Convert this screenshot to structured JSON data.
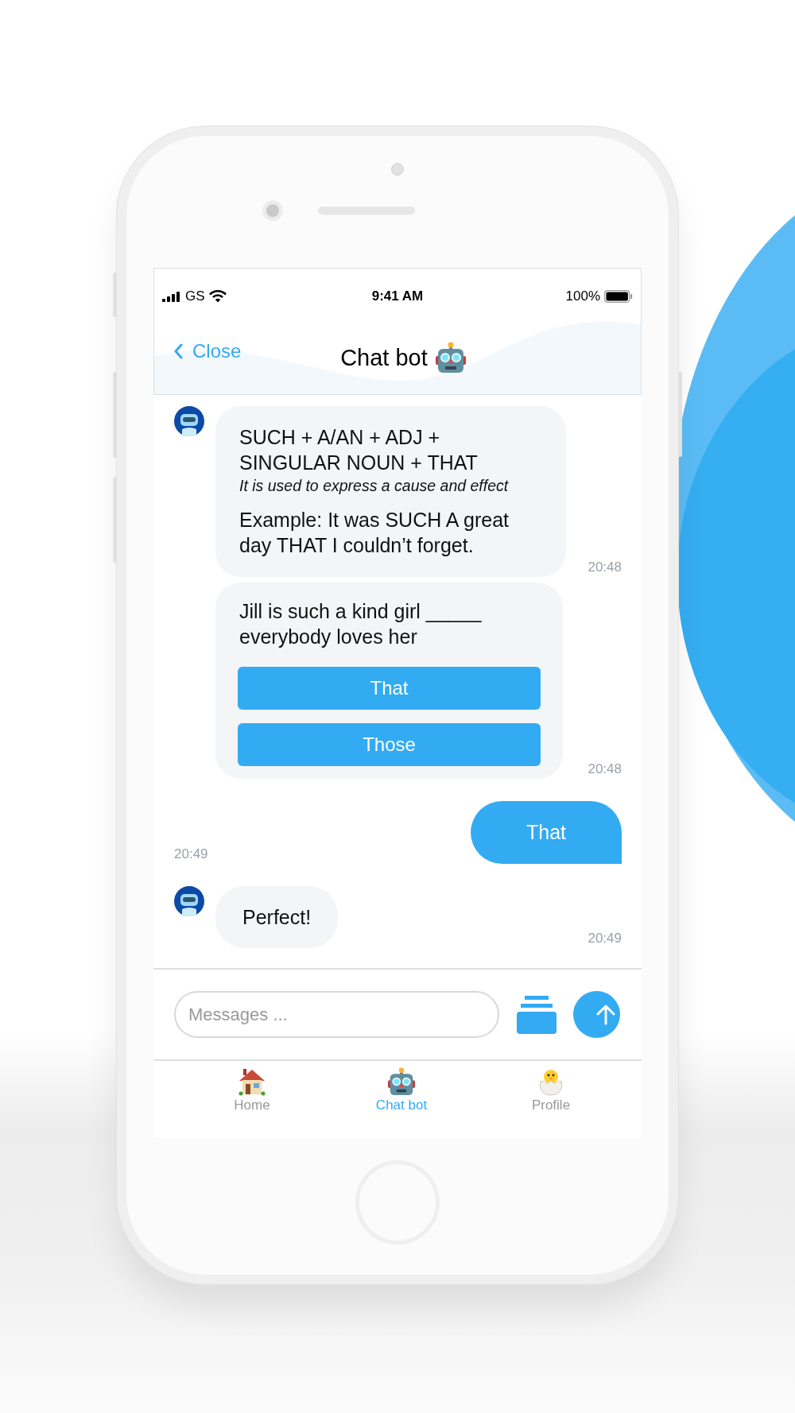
{
  "status_bar": {
    "carrier": "GS",
    "time": "9:41 AM",
    "battery": "100%"
  },
  "header": {
    "back": "Close",
    "title": "Chat bot"
  },
  "messages": [
    {
      "kind": "lesson",
      "avatar": true,
      "rule": "SUCH + A/AN + ADJ + SINGULAR NOUN + THAT",
      "note": "It is used to express a cause and effect",
      "example": "Example: It was SUCH A great day THAT I couldn’t forget.",
      "time": "20:48"
    },
    {
      "kind": "quiz",
      "avatar": false,
      "question": "Jill is such a kind girl _____ everybody loves her",
      "options": [
        {
          "label": "That"
        },
        {
          "label": "Those"
        }
      ],
      "time": "20:48"
    },
    {
      "kind": "user_text",
      "text": "That",
      "time": "20:49"
    },
    {
      "kind": "bot_text",
      "avatar": true,
      "text": "Perfect!",
      "time": "20:49"
    }
  ],
  "composer": {
    "placeholder": "Messages ..."
  },
  "tabs": [
    {
      "kind": "house",
      "label": "Home",
      "selected": false
    },
    {
      "kind": "robot",
      "label": "Chat bot",
      "selected": true
    },
    {
      "kind": "chick",
      "label": "Profile",
      "selected": false
    }
  ]
}
